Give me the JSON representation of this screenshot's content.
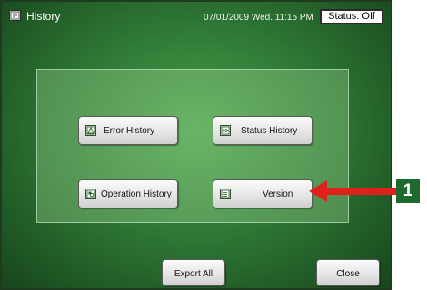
{
  "header": {
    "title": "History",
    "datetime": "07/01/2009 Wed. 11:15 PM",
    "status": "Status: Off",
    "icon": "history-icon"
  },
  "buttons": {
    "error_history": {
      "label": "Error History",
      "icon": "error-history-icon"
    },
    "status_history": {
      "label": "Status History",
      "icon": "status-history-icon"
    },
    "operation_history": {
      "label": "Operation History",
      "icon": "operation-history-icon"
    },
    "version": {
      "label": "Version",
      "icon": "version-icon"
    },
    "export_all": {
      "label": "Export All"
    },
    "close": {
      "label": "Close"
    }
  },
  "callout": {
    "number": "1",
    "color": "#e0211b",
    "badge_color": "#1e6a2e"
  },
  "colors": {
    "screen_bg": "#2f7a36",
    "panel_bg": "#6cbf6c"
  }
}
